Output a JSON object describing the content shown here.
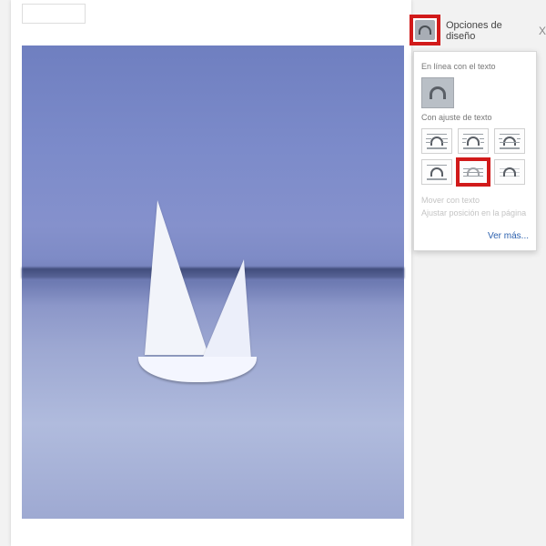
{
  "panel": {
    "title": "Opciones de diseño",
    "close": "X",
    "section_inline": "En línea con el texto",
    "section_wrap": "Con ajuste de texto",
    "disabled_move": "Mover con texto",
    "disabled_fix": "Ajustar posición en la página",
    "see_more": "Ver más..."
  },
  "options": {
    "inline": "inline-with-text",
    "row1": [
      "square",
      "tight",
      "through"
    ],
    "row2": [
      "top-bottom",
      "behind-text",
      "in-front-of-text"
    ],
    "selected": "behind-text"
  },
  "image": {
    "alt": "sailboat on calm water"
  }
}
